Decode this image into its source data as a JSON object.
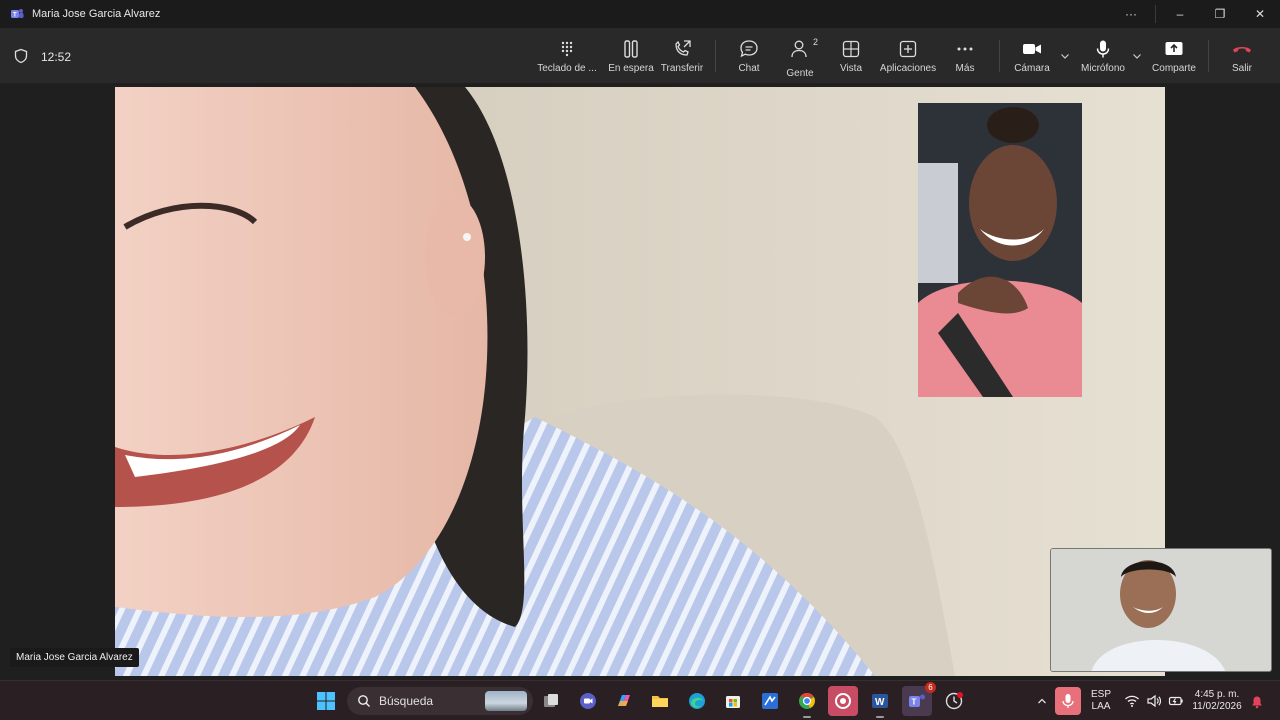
{
  "window": {
    "title": "Maria Jose Garcia Alvarez",
    "controls": {
      "more": "···",
      "minimize": "–",
      "restore": "❐",
      "close": "✕"
    }
  },
  "call": {
    "timer": "12:52",
    "toolbar": {
      "dialpad": "Teclado de ...",
      "hold": "En espera",
      "transfer": "Transferir",
      "chat": "Chat",
      "people": "Gente",
      "people_count": "2",
      "view": "Vista",
      "apps": "Aplicaciones",
      "more": "Más",
      "camera": "Cámara",
      "mic": "Micrófono",
      "share": "Comparte",
      "leave": "Salir"
    },
    "participant_name": "Maria Jose Garcia Alvarez"
  },
  "taskbar": {
    "search_placeholder": "Búsqueda",
    "chrome_badge": "",
    "teams_badge": "6",
    "lang_top": "ESP",
    "lang_bottom": "LAA",
    "time": "4:45 p. m.",
    "date": "11/02/2026"
  },
  "colors": {
    "accent": "#6264a7",
    "leave_red": "#e2435a",
    "toolbar_bg": "#292929",
    "mic_tray": "#e8707a"
  }
}
